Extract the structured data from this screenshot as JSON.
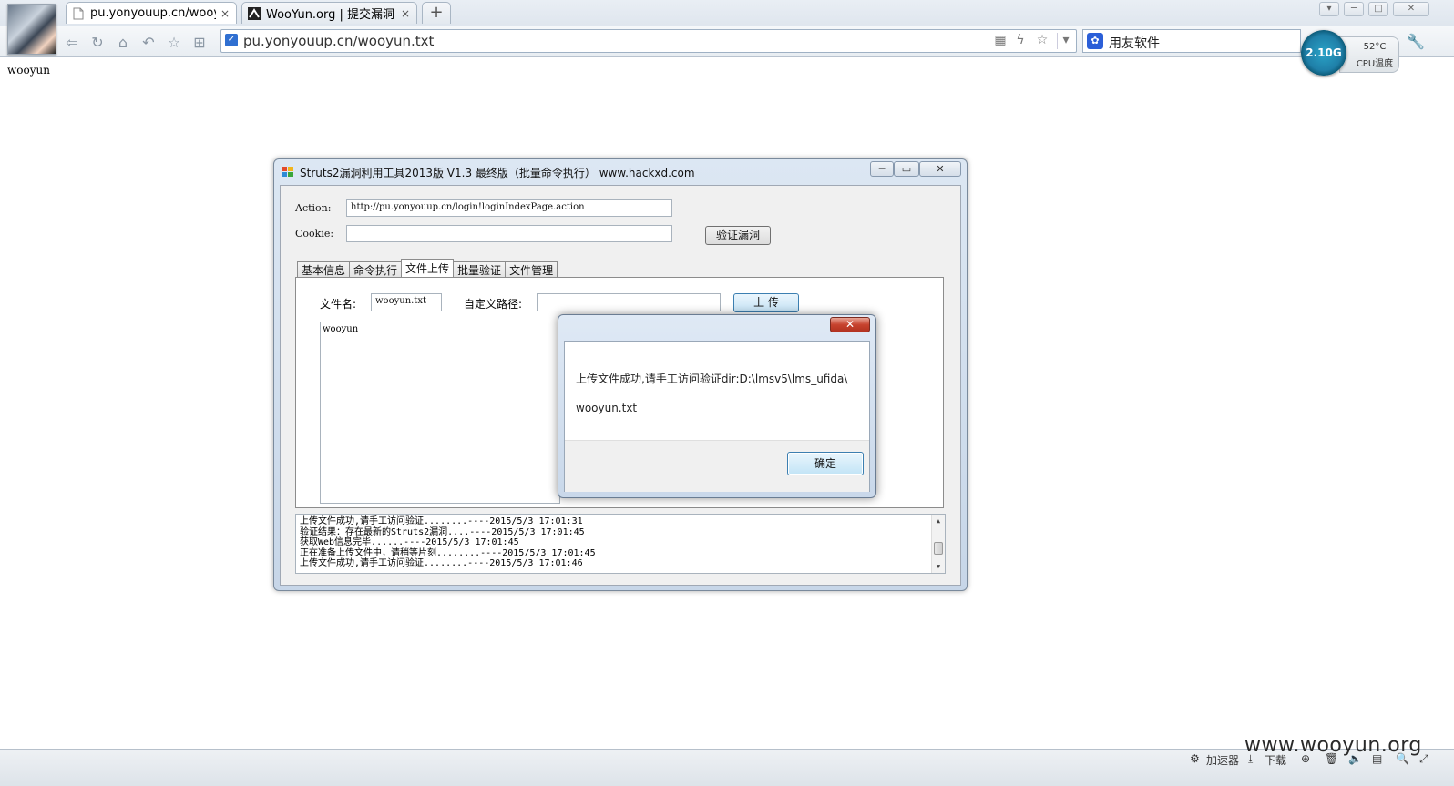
{
  "browser": {
    "tabs": [
      {
        "title": "pu.yonyouup.cn/wooyun.t",
        "close": "×",
        "active": true
      },
      {
        "title": "WooYun.org | 提交漏洞",
        "close": "×",
        "active": false
      }
    ],
    "newtab_label": "+",
    "address": "pu.yonyouup.cn/wooyun.txt",
    "search_engine_label": "用友软件",
    "cpu": {
      "usage": "2.10G",
      "temp": "52°C",
      "temp_label": "CPU温度"
    }
  },
  "page": {
    "body_text": "wooyun"
  },
  "app": {
    "title": "Struts2漏洞利用工具2013版 V1.3 最终版（批量命令执行）   www.hackxd.com",
    "action_label": "Action:",
    "action_value": "http://pu.yonyouup.cn/login!loginIndexPage.action",
    "cookie_label": "Cookie:",
    "cookie_value": "",
    "verify_button": "验证漏洞",
    "tabs": [
      "基本信息",
      "命令执行",
      "文件上传",
      "批量验证",
      "文件管理"
    ],
    "active_tab": "文件上传",
    "upload": {
      "filename_label": "文件名:",
      "filename_value": "wooyun.txt",
      "path_label": "自定义路径:",
      "path_value": "",
      "upload_button": "上 传",
      "file_content": "wooyun"
    },
    "log": [
      "上传文件成功,请手工访问验证........----2015/5/3 17:01:31",
      "验证结果：存在最新的Struts2漏洞....----2015/5/3 17:01:45",
      "获取Web信息完毕......----2015/5/3 17:01:45",
      "正在准备上传文件中，请稍等片刻........----2015/5/3 17:01:45",
      "上传文件成功,请手工访问验证........----2015/5/3 17:01:46"
    ]
  },
  "dialog": {
    "message_line1": "上传文件成功,请手工访问验证dir:D:\\lmsv5\\lms_ufida\\",
    "message_line2": "wooyun.txt",
    "ok_button": "确定",
    "close": "✕"
  },
  "statusbar": {
    "accelerator": "加速器",
    "download": "下载",
    "watermark": "www.wooyun.org"
  }
}
